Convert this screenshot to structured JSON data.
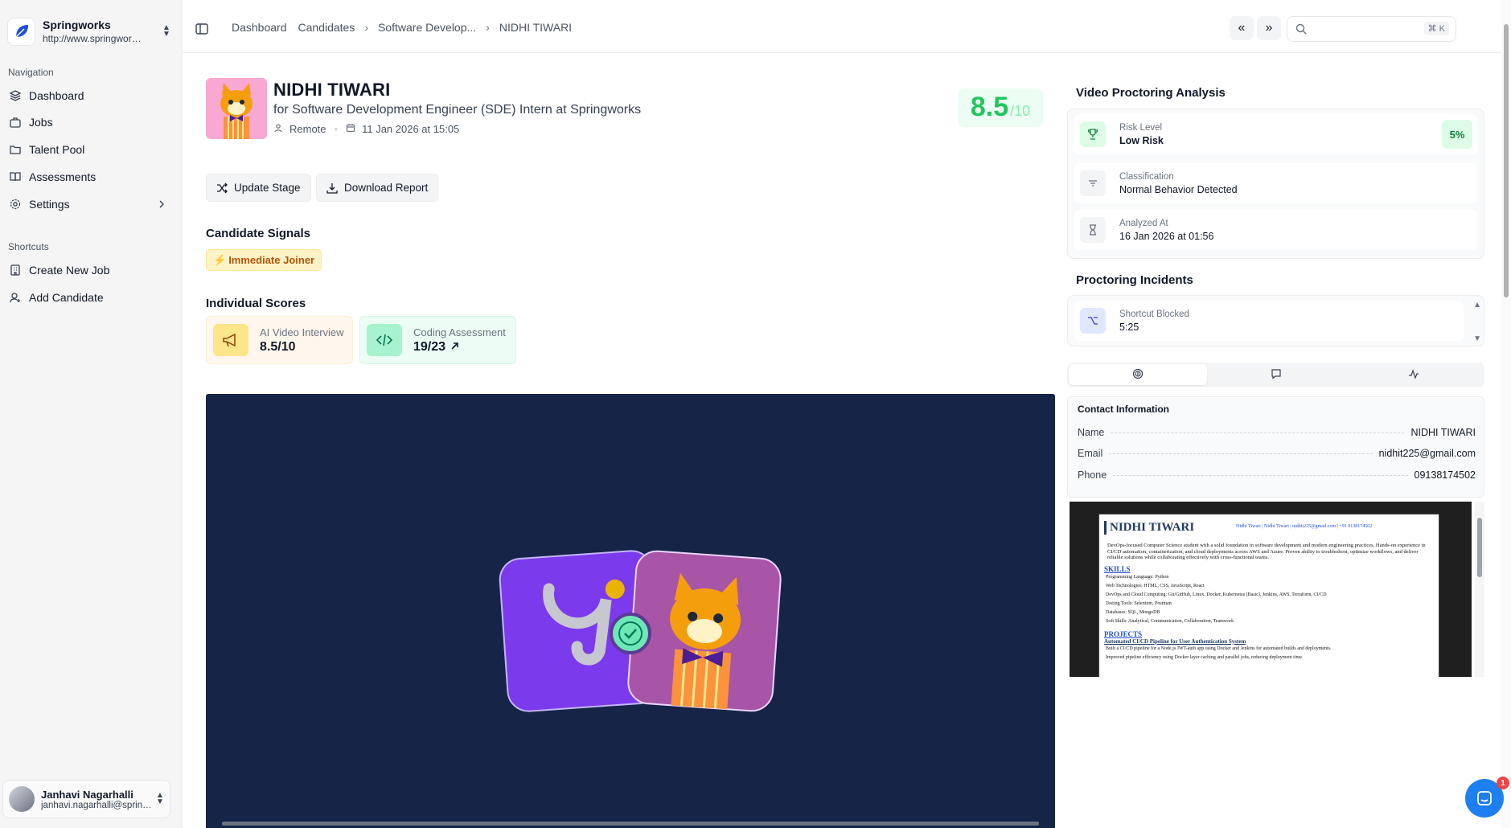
{
  "org": {
    "name": "Springworks",
    "url": "http://www.springworks.in"
  },
  "sidebar": {
    "navigation_label": "Navigation",
    "items": [
      {
        "label": "Dashboard",
        "icon": "layers-icon"
      },
      {
        "label": "Jobs",
        "icon": "briefcase-icon"
      },
      {
        "label": "Talent Pool",
        "icon": "folder-icon"
      },
      {
        "label": "Assessments",
        "icon": "book-icon"
      },
      {
        "label": "Settings",
        "icon": "gear-icon"
      }
    ],
    "shortcuts_label": "Shortcuts",
    "shortcuts": [
      {
        "label": "Create New Job",
        "icon": "building-icon"
      },
      {
        "label": "Add Candidate",
        "icon": "user-plus-icon"
      }
    ]
  },
  "user": {
    "name": "Janhavi Nagarhalli",
    "email": "janhavi.nagarhalli@springworks.in"
  },
  "breadcrumb": {
    "items": [
      "Dashboard",
      "Candidates",
      "Software Develop...",
      "NIDHI TIWARI"
    ]
  },
  "search": {
    "placeholder": "",
    "shortcut": "⌘ K"
  },
  "candidate": {
    "name": "NIDHI TIWARI",
    "role_line": "for Software Development Engineer (SDE) Intern at Springworks",
    "location": "Remote",
    "date": "11 Jan 2026 at 15:05",
    "score": "8.5",
    "score_den": "/10"
  },
  "actions": {
    "update_stage": "Update Stage",
    "download_report": "Download Report"
  },
  "signals": {
    "title": "Candidate Signals",
    "items": [
      "Immediate Joiner"
    ]
  },
  "scores": {
    "title": "Individual Scores",
    "items": [
      {
        "label": "AI Video Interview",
        "value": "8.5/10"
      },
      {
        "label": "Coding Assessment",
        "value": "19/23"
      }
    ]
  },
  "proctoring": {
    "title": "Video Proctoring Analysis",
    "risk_label": "Risk Level",
    "risk_value": "Low Risk",
    "risk_percent": "5%",
    "class_label": "Classification",
    "class_value": "Normal Behavior Detected",
    "analyzed_label": "Analyzed At",
    "analyzed_value": "16 Jan 2026 at 01:56"
  },
  "incidents": {
    "title": "Proctoring Incidents",
    "items": [
      {
        "label": "Shortcut Blocked",
        "time": "5:25"
      }
    ]
  },
  "contact": {
    "title": "Contact Information",
    "name_label": "Name",
    "name": "NIDHI TIWARI",
    "email_label": "Email",
    "email": "nidhit225@gmail.com",
    "phone_label": "Phone",
    "phone": "09138174502"
  },
  "resume": {
    "name": "NIDHI TIWARI",
    "contact_line": "Nidhi Tiwari | Nidhi Tiwari | nidhit225@gmail.com | +91 9138174502",
    "summary": "DevOps-focused Computer Science student with a solid foundation in software development and modern engineering practices. Hands-on experience in CI/CD automation, containerization, and cloud deployments across AWS and Azure. Proven ability to troubleshoot, optimize workflows, and deliver reliable solutions while collaborating effectively with cross-functional teams.",
    "skills_heading": "SKILLS",
    "skills": [
      "Programming Language: Python",
      "Web Technologies: HTML, CSS, JavaScript, React",
      "DevOps and Cloud Computing: Git/GitHub, Linux, Docker, Kubernetes (Basic), Jenkins, AWS, Terraform, CI/CD",
      "Testing Tools: Selenium, Postman",
      "Databases: SQL, MongoDB",
      "Soft Skills: Analytical, Communication, Collaboration, Teamwork"
    ],
    "projects_heading": "PROJECTS",
    "project_title": "Automated CI/CD Pipeline for User Authentication System",
    "project_points": [
      "Built a CI/CD pipeline for a Node.js JWT-auth app using Docker and Jenkins for automated builds and deployments.",
      "Improved pipeline efficiency using Docker layer caching and parallel jobs, reducing deployment time."
    ]
  },
  "chat": {
    "badge": "1"
  },
  "colors": {
    "accent_green": "#22c55e",
    "video_bg": "#152447",
    "signal": "#b45309"
  }
}
